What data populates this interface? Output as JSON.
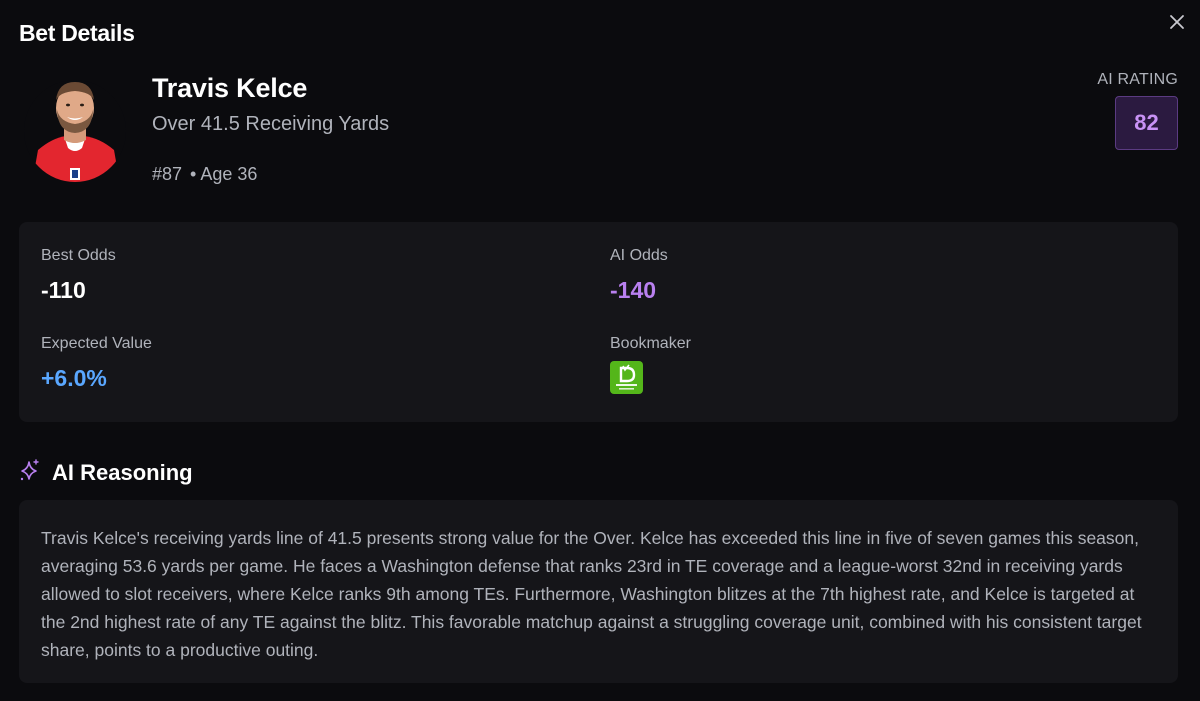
{
  "modal": {
    "title": "Bet Details",
    "close_icon": "close-icon"
  },
  "player": {
    "name": "Travis Kelce",
    "bet": "Over 41.5 Receiving Yards",
    "number": "#87",
    "age": "• Age 36",
    "avatar_icon": "player-headshot"
  },
  "ai_rating": {
    "label": "AI RATING",
    "value": "82",
    "color": "#c892f5"
  },
  "stats": {
    "best_odds": {
      "label": "Best Odds",
      "value": "-110"
    },
    "ai_odds": {
      "label": "AI Odds",
      "value": "-140",
      "color": "#b980f0"
    },
    "expected_value": {
      "label": "Expected Value",
      "value": "+6.0%",
      "color": "#5aa7ff"
    },
    "bookmaker": {
      "label": "Bookmaker",
      "logo": "draftkings-sportsbook-logo",
      "logo_text": "SPORTSBOOK & CASINO"
    }
  },
  "reasoning": {
    "title": "AI Reasoning",
    "icon": "sparkles-icon",
    "text": "Travis Kelce's receiving yards line of 41.5 presents strong value for the Over. Kelce has exceeded this line in five of seven games this season, averaging 53.6 yards per game. He faces a Washington defense that ranks 23rd in TE coverage and a league-worst 32nd in receiving yards allowed to slot receivers, where Kelce ranks 9th among TEs. Furthermore, Washington blitzes at the 7th highest rate, and Kelce is targeted at the 2nd highest rate of any TE against the blitz. This favorable matchup against a struggling coverage unit, combined with his consistent target share, points to a productive outing."
  }
}
